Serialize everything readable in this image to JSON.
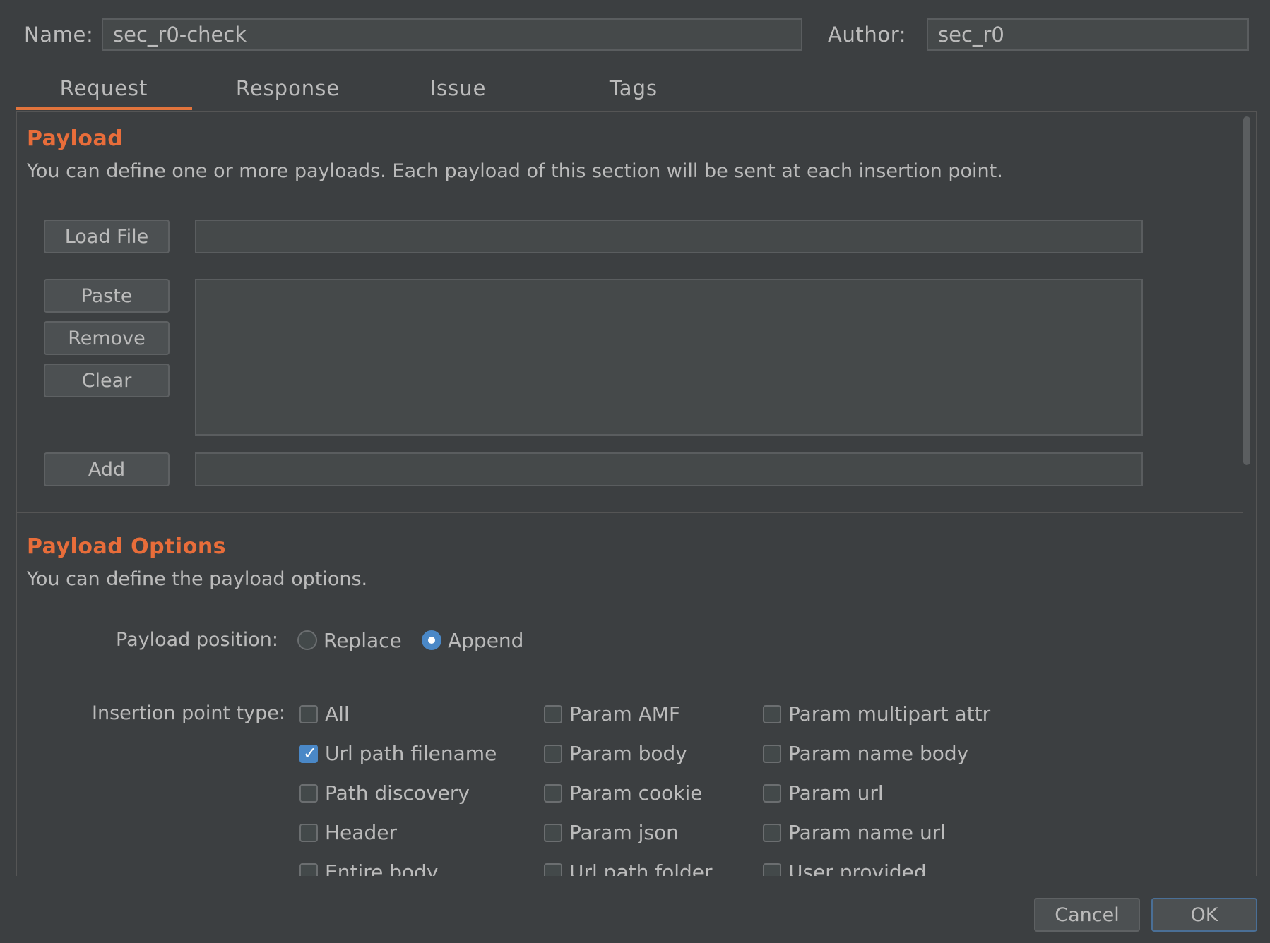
{
  "header": {
    "name_label": "Name:",
    "name_value": "sec_r0-check",
    "author_label": "Author:",
    "author_value": "sec_r0"
  },
  "tabs": [
    {
      "label": "Request",
      "active": true
    },
    {
      "label": "Response",
      "active": false
    },
    {
      "label": "Issue",
      "active": false
    },
    {
      "label": "Tags",
      "active": false
    }
  ],
  "payload": {
    "title": "Payload",
    "description": "You can define one or more payloads. Each payload of this section will be sent at each insertion point.",
    "load_file_label": "Load File",
    "load_file_value": "",
    "paste_label": "Paste",
    "remove_label": "Remove",
    "clear_label": "Clear",
    "add_label": "Add",
    "add_value": ""
  },
  "payload_options": {
    "title": "Payload Options",
    "description": "You can define the payload options.",
    "position_label": "Payload position:",
    "position_options": [
      {
        "label": "Replace",
        "selected": false
      },
      {
        "label": "Append",
        "selected": true
      }
    ],
    "insertion_label": "Insertion point type:",
    "insertion_points": [
      {
        "label": "All",
        "checked": false
      },
      {
        "label": "Param AMF",
        "checked": false
      },
      {
        "label": "Param multipart attr",
        "checked": false
      },
      {
        "label": "Url path filename",
        "checked": true
      },
      {
        "label": "Param body",
        "checked": false
      },
      {
        "label": "Param name body",
        "checked": false
      },
      {
        "label": "Path discovery",
        "checked": false
      },
      {
        "label": "Param cookie",
        "checked": false
      },
      {
        "label": "Param url",
        "checked": false
      },
      {
        "label": "Header",
        "checked": false
      },
      {
        "label": "Param json",
        "checked": false
      },
      {
        "label": "Param name url",
        "checked": false
      },
      {
        "label": "Entire body",
        "checked": false
      },
      {
        "label": "Url path folder",
        "checked": false
      },
      {
        "label": "User provided",
        "checked": false
      }
    ]
  },
  "footer": {
    "cancel_label": "Cancel",
    "ok_label": "OK"
  },
  "colors": {
    "background": "#3c3f41",
    "accent": "#e86d3a",
    "selection": "#4a88c7"
  }
}
